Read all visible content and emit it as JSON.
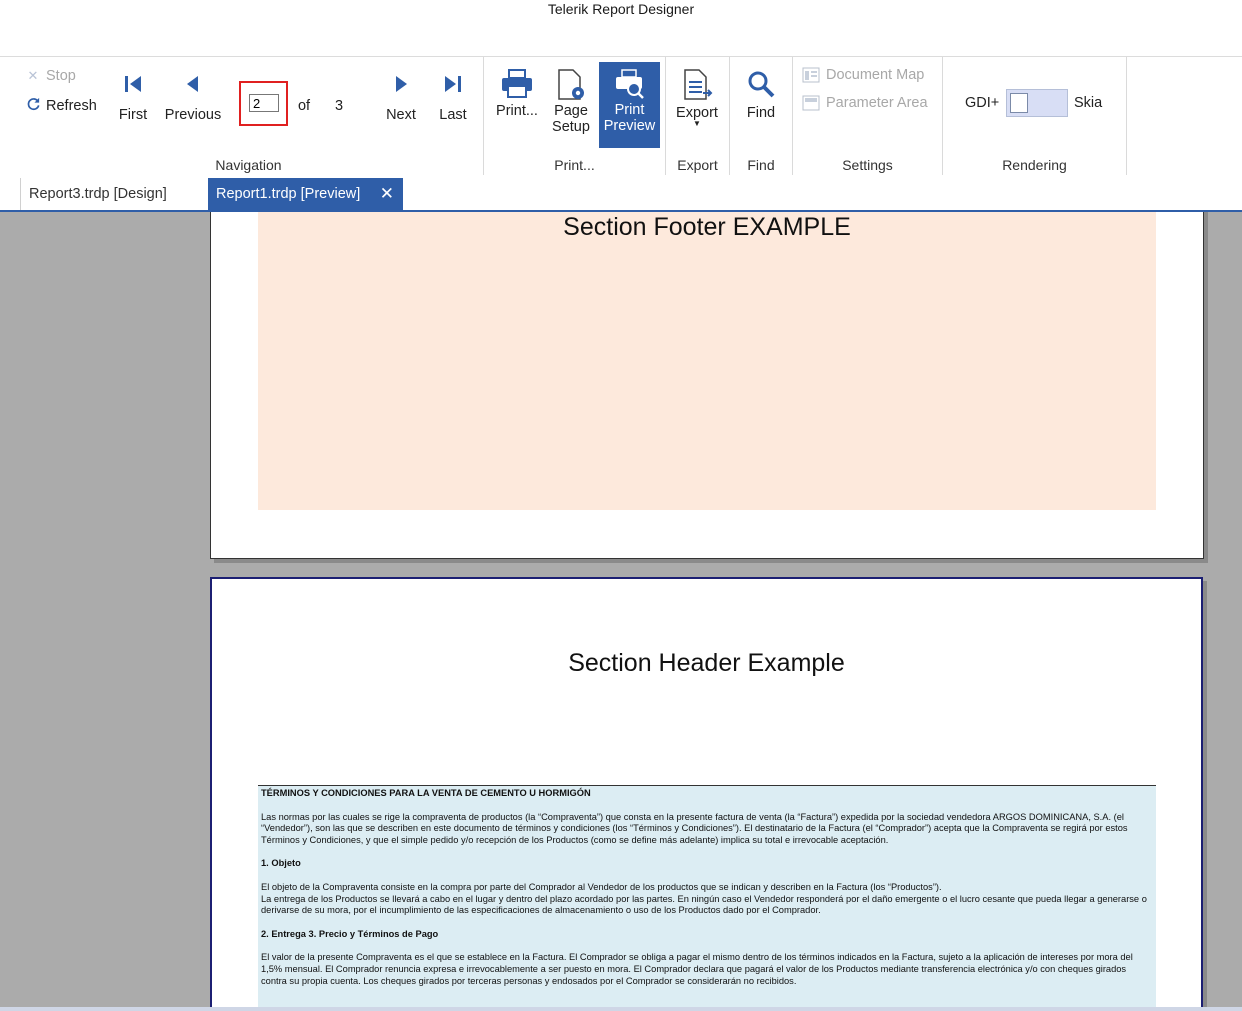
{
  "window": {
    "title": "Telerik Report Designer"
  },
  "ribbon": {
    "navigation": {
      "label": "Navigation",
      "stop": "Stop",
      "refresh": "Refresh",
      "first": "First",
      "previous": "Previous",
      "page_value": "2",
      "of": "of",
      "total": "3",
      "next": "Next",
      "last": "Last"
    },
    "print": {
      "label": "Print...",
      "print": "Print...",
      "page_setup_1": "Page",
      "page_setup_2": "Setup",
      "print_preview_1": "Print",
      "print_preview_2": "Preview"
    },
    "export": {
      "label": "Export",
      "button": "Export"
    },
    "find": {
      "label": "Find",
      "button": "Find"
    },
    "settings": {
      "label": "Settings",
      "document_map": "Document Map",
      "parameter_area": "Parameter Area"
    },
    "rendering": {
      "label": "Rendering",
      "gdi": "GDI+",
      "skia": "Skia"
    }
  },
  "tabs": [
    {
      "label": "Report3.trdp [Design]"
    },
    {
      "label": "Report1.trdp [Preview]"
    }
  ],
  "report": {
    "section_footer": "Section Footer EXAMPLE",
    "section_header": "Section Header Example",
    "terms": {
      "title": "TÉRMINOS Y CONDICIONES PARA LA VENTA DE CEMENTO U HORMIGÓN",
      "p1": "Las normas por las cuales se rige la compraventa de productos (la “Compraventa”) que consta en la presente factura de venta (la “Factura”) expedida por la sociedad vendedora ARGOS DOMINICANA, S.A. (el “Vendedor”), son las que se describen en este documento de términos y condiciones (los “Términos y Condiciones”). El destinatario de la Factura (el “Comprador”) acepta que la Compraventa se regirá por estos Términos y Condiciones, y que el simple pedido y/o recepción de los Productos (como se define más adelante) implica su total e irrevocable aceptación.",
      "h1": "1. Objeto",
      "p2a": "El objeto de la Compraventa consiste en la compra por parte del Comprador al Vendedor de los productos que se indican y describen en la Factura (los “Productos”).",
      "p2b": "La entrega de los Productos se llevará a cabo en el lugar y dentro del plazo acordado por las partes. En ningún caso el Vendedor responderá por el daño emergente o el lucro cesante que pueda llegar a generarse o derivarse de su mora, por el incumplimiento de las especificaciones de almacenamiento o uso de los Productos dado por el Comprador.",
      "h2": "2. Entrega  3. Precio y Términos de Pago",
      "p3": "El valor de la presente Compraventa es el que se establece en la Factura. El Comprador se obliga a pagar el mismo dentro de los términos indicados en la Factura, sujeto a la aplicación de intereses por mora del 1,5% mensual. El Comprador renuncia expresa e irrevocablemente a ser puesto en mora. El Comprador declara que pagará el valor de los Productos mediante transferencia electrónica y/o con cheques girados contra su propia cuenta. Los cheques girados por terceras personas y endosados por el Comprador se considerarán no recibidos."
    }
  },
  "colors": {
    "accent": "#2f5ea8",
    "footer_band": "#fde9dc",
    "terms_band": "#dcedf3",
    "viewer_bg": "#ababab",
    "highlight_border": "#e02020"
  }
}
